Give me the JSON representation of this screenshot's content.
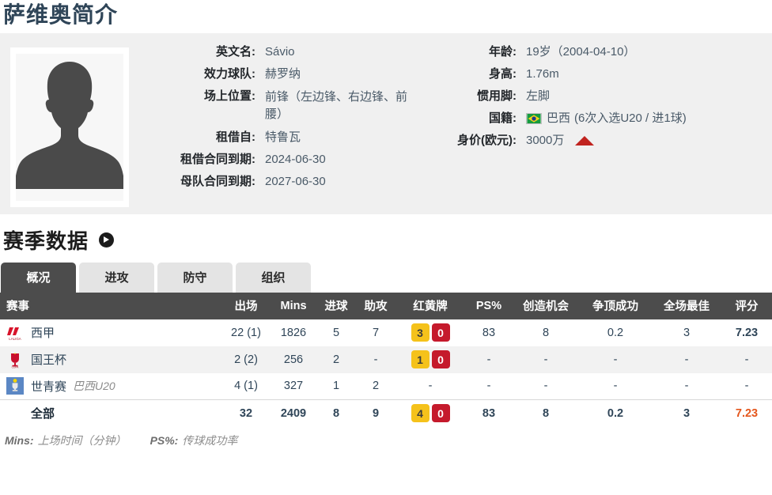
{
  "page_title": "萨维奥简介",
  "colors": {
    "title": "#2f4558",
    "panel_bg": "#f0f0f0",
    "header_bg": "#4c4c4c",
    "rating": "#e4561c",
    "yellow_card": "#f5c21b",
    "red_card": "#c51a2c",
    "value_up": "#c0231f"
  },
  "photo": {
    "alt": "player-photo-placeholder"
  },
  "profile": {
    "left": [
      {
        "label": "英文名:",
        "value": "Sávio"
      },
      {
        "label": "效力球队:",
        "value": "赫罗纳"
      },
      {
        "label": "场上位置:",
        "value": "前锋（左边锋、右边锋、前腰）"
      },
      {
        "label": "租借自:",
        "value": "特鲁瓦"
      },
      {
        "label": "租借合同到期:",
        "value": "2024-06-30"
      },
      {
        "label": "母队合同到期:",
        "value": "2027-06-30"
      }
    ],
    "right": [
      {
        "label": "年龄:",
        "value": "19岁（2004-04-10）"
      },
      {
        "label": "身高:",
        "value": "1.76m"
      },
      {
        "label": "惯用脚:",
        "value": "左脚"
      },
      {
        "label": "国籍:",
        "value": "巴西",
        "sub": "(6次入选U20 / 进1球)",
        "flag": "brazil-flag"
      },
      {
        "label": "身价(欧元):",
        "value": "3000万",
        "trend": "up-triangle"
      }
    ]
  },
  "season": {
    "heading": "赛季数据",
    "arrow_icon": "arrow-right-circle-icon",
    "tabs": [
      {
        "label": "概况",
        "active": true
      },
      {
        "label": "进攻",
        "active": false
      },
      {
        "label": "防守",
        "active": false
      },
      {
        "label": "组织",
        "active": false
      }
    ]
  },
  "table": {
    "columns": [
      "赛事",
      "出场",
      "Mins",
      "进球",
      "助攻",
      "红黄牌",
      "PS%",
      "创造机会",
      "争顶成功",
      "全场最佳",
      "评分"
    ],
    "rows": [
      {
        "comp": "西甲",
        "comp_sub": "",
        "icon": "laliga-icon",
        "apps": "22 (1)",
        "mins": "1826",
        "goals": "5",
        "assists": "7",
        "yellow": "3",
        "red": "0",
        "ps": "83",
        "chances": "8",
        "aerial": "0.2",
        "motm": "3",
        "rating": "7.23"
      },
      {
        "comp": "国王杯",
        "comp_sub": "",
        "icon": "copa-del-rey-icon",
        "apps": "2 (2)",
        "mins": "256",
        "goals": "2",
        "assists": "-",
        "yellow": "1",
        "red": "0",
        "ps": "-",
        "chances": "-",
        "aerial": "-",
        "motm": "-",
        "rating": "-"
      },
      {
        "comp": "世青赛",
        "comp_sub": "巴西U20",
        "icon": "u20-world-cup-icon",
        "apps": "4 (1)",
        "mins": "327",
        "goals": "1",
        "assists": "2",
        "yellow": "-",
        "red": "",
        "ps": "-",
        "chances": "-",
        "aerial": "-",
        "motm": "-",
        "rating": "-"
      }
    ],
    "total": {
      "comp": "全部",
      "apps": "32",
      "mins": "2409",
      "goals": "8",
      "assists": "9",
      "yellow": "4",
      "red": "0",
      "ps": "83",
      "chances": "8",
      "aerial": "0.2",
      "motm": "3",
      "rating": "7.23"
    }
  },
  "footnote": {
    "mins_key": "Mins:",
    "mins_text": "上场时间（分钟）",
    "ps_key": "PS%:",
    "ps_text": "传球成功率"
  }
}
